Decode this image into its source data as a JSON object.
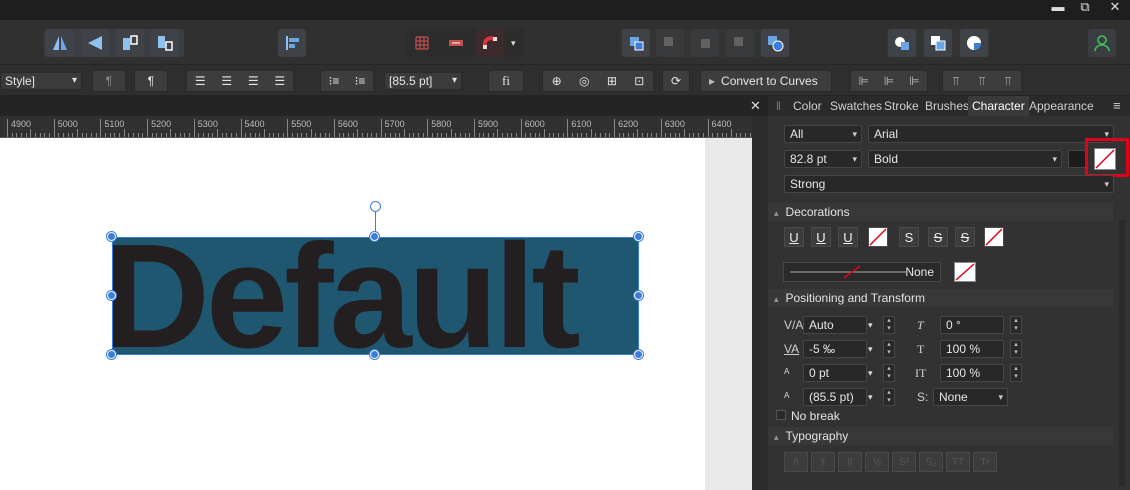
{
  "window": {
    "minimize_glyph": "▬",
    "restore_glyph": "⧉",
    "close_glyph": "✕"
  },
  "toolbar2": {
    "style_value": "Style]",
    "pilcrow_icon": "¶",
    "pilcrow_bold": "¶",
    "size_value": "[85.5 pt]",
    "fi_label": "fi",
    "convert_label": "Convert to Curves"
  },
  "ruler": {
    "labels": [
      "4900",
      "5000",
      "5100",
      "5200",
      "5300",
      "5400",
      "5500",
      "5600",
      "5700",
      "5800",
      "5900",
      "6000",
      "6100",
      "6200",
      "6300",
      "6400"
    ]
  },
  "canvas": {
    "text": "Default",
    "selection_color": "#1f5670",
    "text_color": "#231f20"
  },
  "panel": {
    "tabs": [
      "Color",
      "Swatches",
      "Stroke",
      "Brushes",
      "Character",
      "Appearance"
    ],
    "active_tab": "Character",
    "close_glyph": "✕",
    "menu_glyph": "≡",
    "scope": "All",
    "font_family": "Arial",
    "font_size": "82.8 pt",
    "font_weight": "Bold",
    "font_variant": "Strong",
    "decorations": {
      "title": "Decorations",
      "underline_labels": [
        "U",
        "U",
        "U"
      ],
      "strike_labels": [
        "S",
        "S",
        "S"
      ],
      "line_label": "None"
    },
    "positioning": {
      "title": "Positioning and Transform",
      "kerning": "Auto",
      "tracking": "-5 ‰",
      "baseline": "0 pt",
      "leading": "(85.5 pt)",
      "shear": "0 °",
      "vscale": "100 %",
      "hscale": "100 %",
      "script_label": "S:",
      "script_value": "None",
      "nobreak_label": "No break"
    },
    "typography": {
      "title": "Typography",
      "buttons": [
        "fi",
        "ꬵ",
        "ll",
        "½",
        "S²",
        "S₂",
        "TT",
        "Tr"
      ]
    }
  },
  "colors": {
    "accent": "#3b7dd8",
    "highlight": "#e0001a",
    "active_tab_bg": "#3a3a3a"
  }
}
